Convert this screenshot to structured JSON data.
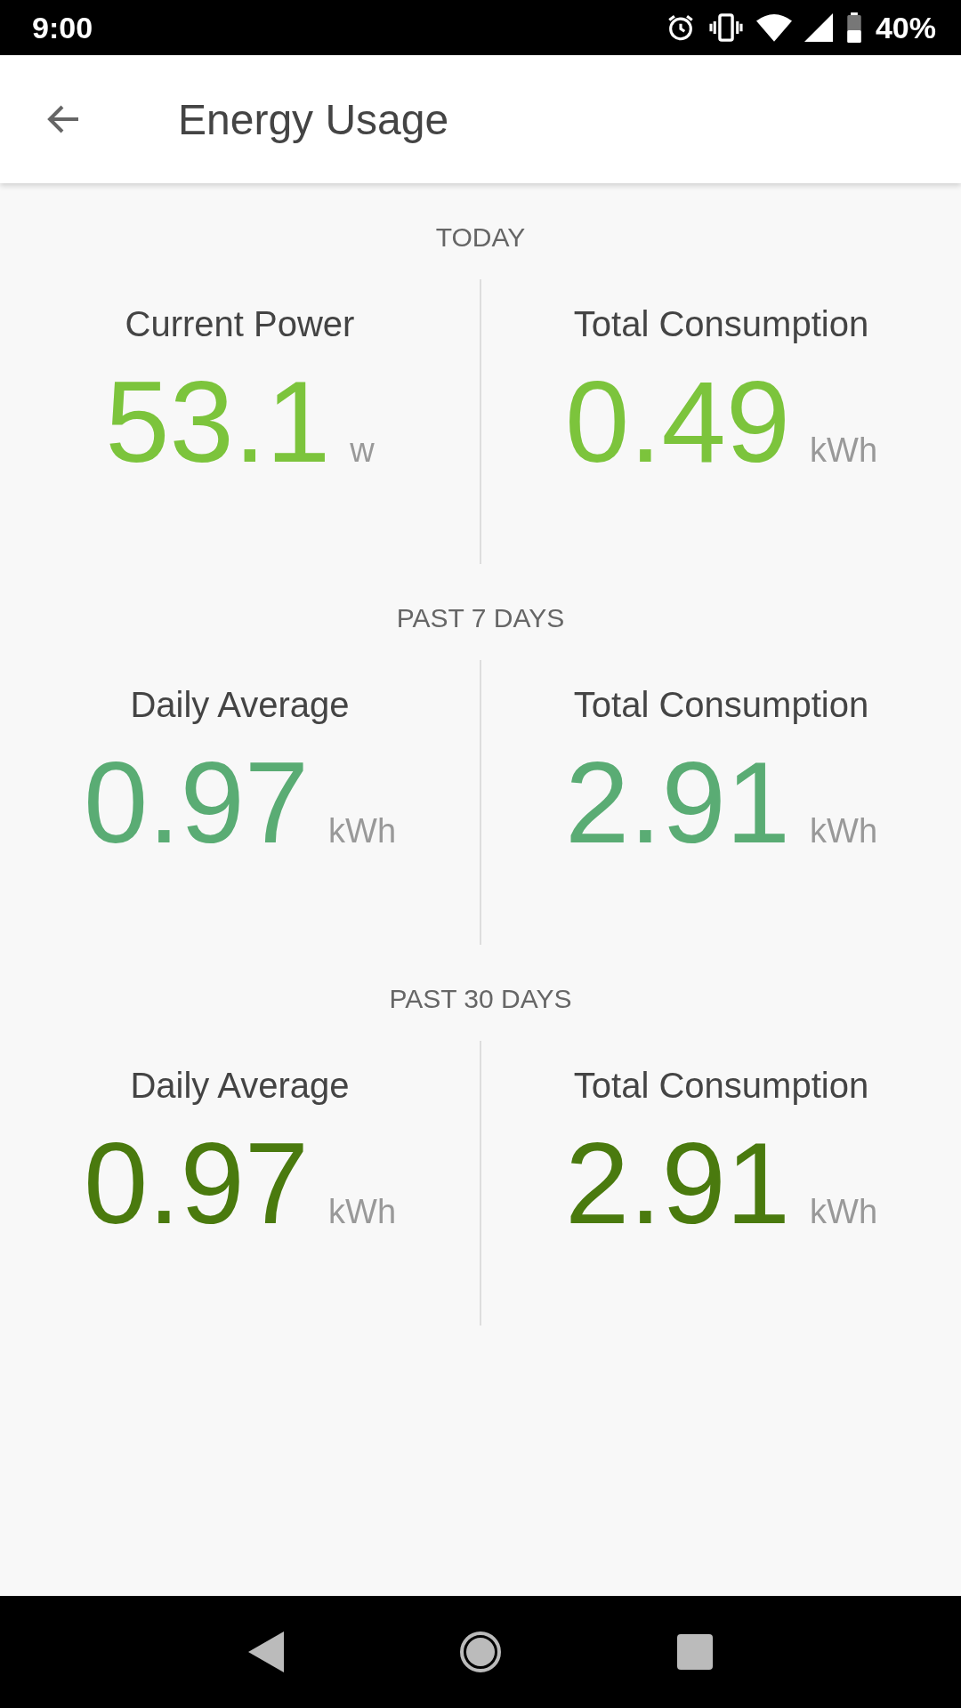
{
  "status_bar": {
    "time": "9:00",
    "battery": "40%"
  },
  "app_bar": {
    "title": "Energy Usage"
  },
  "sections": [
    {
      "heading": "TODAY",
      "color": "#7cc43c",
      "metrics": [
        {
          "label": "Current Power",
          "value": "53.1",
          "unit": "w"
        },
        {
          "label": "Total Consumption",
          "value": "0.49",
          "unit": "kWh"
        }
      ]
    },
    {
      "heading": "PAST 7 DAYS",
      "color": "#5aac74",
      "metrics": [
        {
          "label": "Daily Average",
          "value": "0.97",
          "unit": "kWh"
        },
        {
          "label": "Total Consumption",
          "value": "2.91",
          "unit": "kWh"
        }
      ]
    },
    {
      "heading": "PAST 30 DAYS",
      "color": "#4a7a0e",
      "metrics": [
        {
          "label": "Daily Average",
          "value": "0.97",
          "unit": "kWh"
        },
        {
          "label": "Total Consumption",
          "value": "2.91",
          "unit": "kWh"
        }
      ]
    }
  ]
}
